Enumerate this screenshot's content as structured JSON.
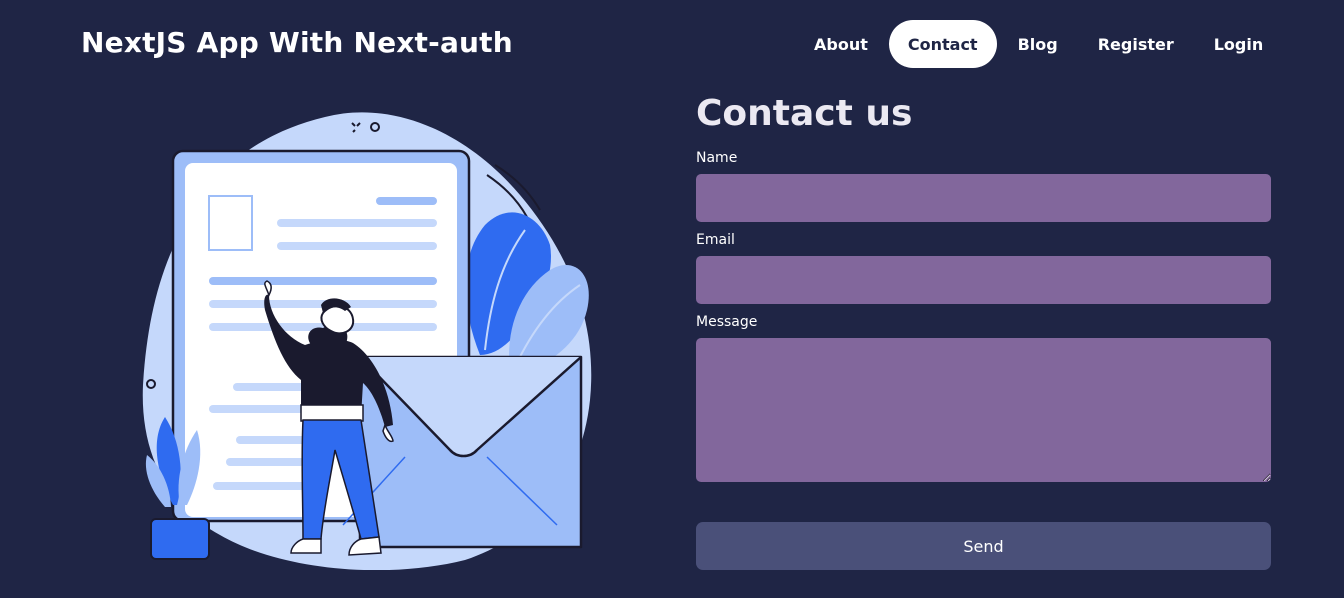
{
  "header": {
    "brand": "NextJS App With Next-auth",
    "nav": [
      {
        "label": "About",
        "active": false
      },
      {
        "label": "Contact",
        "active": true
      },
      {
        "label": "Blog",
        "active": false
      },
      {
        "label": "Register",
        "active": false
      },
      {
        "label": "Login",
        "active": false
      }
    ]
  },
  "contact": {
    "title": "Contact us",
    "name_label": "Name",
    "name_value": "",
    "email_label": "Email",
    "email_value": "",
    "message_label": "Message",
    "message_value": "",
    "send_label": "Send"
  },
  "colors": {
    "background": "#1f2545",
    "field": "#82679c",
    "button": "#4a5079",
    "illustration_blue": "#2f6bf0",
    "illustration_light": "#c5d8fb"
  }
}
